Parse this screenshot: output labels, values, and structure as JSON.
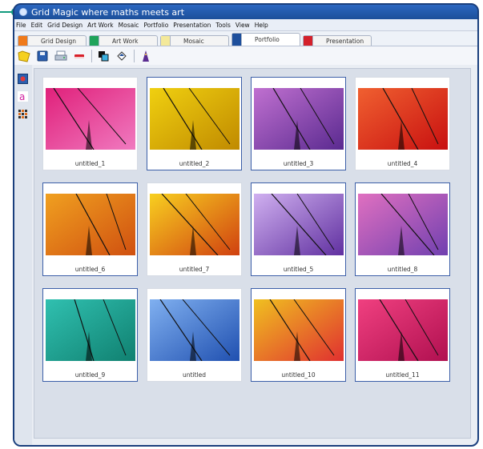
{
  "window": {
    "title": "Grid Magic   where maths meets art"
  },
  "menu": [
    "File",
    "Edit",
    "Grid Design",
    "Art Work",
    "Mosaic",
    "Portfolio",
    "Presentation",
    "Tools",
    "View",
    "Help"
  ],
  "tabs": [
    {
      "label": "Grid Design",
      "color": "#f07a1a"
    },
    {
      "label": "Art Work",
      "color": "#1fa35a"
    },
    {
      "label": "Mosaic",
      "color": "#f4e99a"
    },
    {
      "label": "Portfolio",
      "color": "#1e4f9c"
    },
    {
      "label": "Presentation",
      "color": "#d4202a"
    }
  ],
  "active_tab": "Portfolio",
  "toolbar_icons": [
    "open-folder-icon",
    "save-icon",
    "print-icon",
    "eraser-icon",
    "layers-icon",
    "paint-bucket-icon",
    "wizard-icon"
  ],
  "sidebar_icons": [
    "image-icon",
    "text-a-icon",
    "grid-icon"
  ],
  "portfolio": [
    {
      "name": "untitled_1",
      "colors": [
        "#e0207a",
        "#f07ac0"
      ],
      "selected": false
    },
    {
      "name": "untitled_2",
      "colors": [
        "#f0d010",
        "#c08a00"
      ],
      "selected": true
    },
    {
      "name": "untitled_3",
      "colors": [
        "#c070d0",
        "#5a2a90"
      ],
      "selected": true
    },
    {
      "name": "untitled_4",
      "colors": [
        "#f06030",
        "#c81010"
      ],
      "selected": false
    },
    {
      "name": "untitled_6",
      "colors": [
        "#f0a020",
        "#d05010"
      ],
      "selected": true
    },
    {
      "name": "untitled_7",
      "colors": [
        "#f8d020",
        "#d04010"
      ],
      "selected": false
    },
    {
      "name": "untitled_5",
      "colors": [
        "#d0b0f0",
        "#6030a0"
      ],
      "selected": true
    },
    {
      "name": "untitled_8",
      "colors": [
        "#e070c0",
        "#7040b0"
      ],
      "selected": true
    },
    {
      "name": "untitled_9",
      "colors": [
        "#30c0b0",
        "#108070"
      ],
      "selected": true
    },
    {
      "name": "untitled",
      "colors": [
        "#80b0f0",
        "#2050b0"
      ],
      "selected": false
    },
    {
      "name": "untitled_10",
      "colors": [
        "#f0c020",
        "#e03030"
      ],
      "selected": true
    },
    {
      "name": "untitled_11",
      "colors": [
        "#f04080",
        "#b01050"
      ],
      "selected": true
    }
  ]
}
